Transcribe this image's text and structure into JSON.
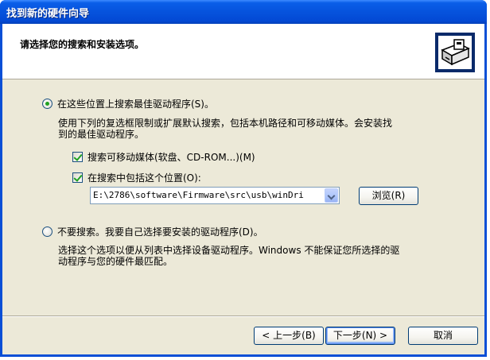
{
  "window": {
    "title": "找到新的硬件向导"
  },
  "header": {
    "title": "请选择您的搜索和安装选项。",
    "icon": "hardware-install-icon"
  },
  "option_search": {
    "label": "在这些位置上搜索最佳驱动程序(S)。",
    "checked": true,
    "description_line1": "使用下列的复选框限制或扩展默认搜索，包括本机路径和可移动媒体。会安装找",
    "description_line2": "到的最佳驱动程序。"
  },
  "checkbox_removable": {
    "label": "搜索可移动媒体(软盘、CD-ROM...)(M)",
    "checked": true
  },
  "checkbox_location": {
    "label": "在搜索中包括这个位置(O):",
    "checked": true
  },
  "path_combo": {
    "value": "E:\\2786\\software\\Firmware\\src\\usb\\winDri"
  },
  "browse_button": {
    "label": "浏览(R)"
  },
  "option_nosearch": {
    "label": "不要搜索。我要自己选择要安装的驱动程序(D)。",
    "checked": false,
    "description_line1": "选择这个选项以便从列表中选择设备驱动程序。Windows 不能保证您所选择的驱",
    "description_line2": "动程序与您的硬件最匹配。"
  },
  "footer": {
    "back_label": "< 上一步(B)",
    "next_label": "下一步(N) >",
    "cancel_label": "取消"
  },
  "colors": {
    "titlebar": "#0653dd",
    "dialog_bg": "#ece9d8",
    "radio_dot": "#21a121"
  }
}
